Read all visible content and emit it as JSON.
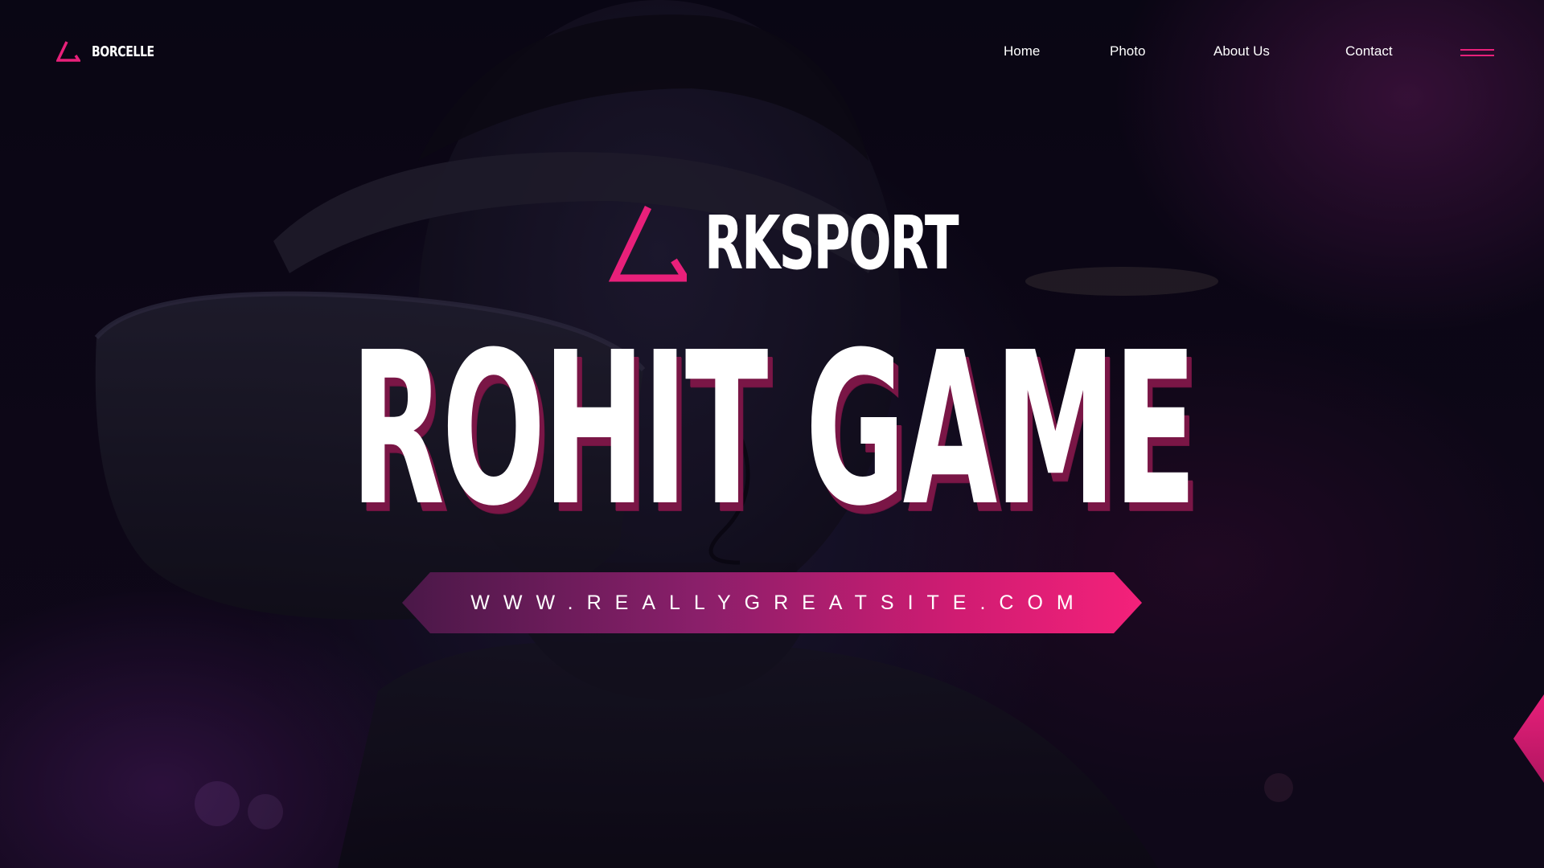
{
  "brand": {
    "name": "BORCELLE",
    "logo_icon": "triangle-logo-icon",
    "accent_color": "#e8207a"
  },
  "nav": {
    "links": [
      {
        "label": "Home"
      },
      {
        "label": "Photo"
      },
      {
        "label": "About Us"
      },
      {
        "label": "Contact"
      }
    ],
    "menu_icon": "hamburger-menu-icon"
  },
  "hero": {
    "logo_text": "RKSPORT",
    "title": "ROHIT GAME",
    "url": "WWW.REALLYGREATSITE.COM",
    "title_shadow_color": "#7a1646"
  },
  "colors": {
    "background": "#0b0716",
    "accent": "#e8207a",
    "banner_gradient_start": "#4a1848",
    "banner_gradient_end": "#f4217a"
  }
}
